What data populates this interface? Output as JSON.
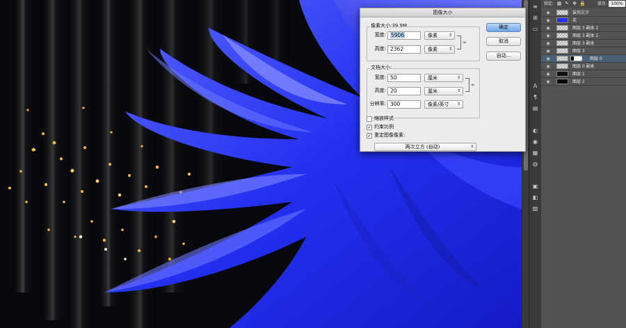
{
  "dialog": {
    "title": "图像大小",
    "pixel_dims": {
      "title": "像素大小:39.9M",
      "width_label": "宽度:",
      "width_value": "5906",
      "width_unit": "像素",
      "height_label": "高度:",
      "height_value": "2362",
      "height_unit": "像素"
    },
    "doc_size": {
      "title": "文档大小:",
      "width_label": "宽度:",
      "width_value": "50",
      "width_unit": "厘米",
      "height_label": "高度:",
      "height_value": "20",
      "height_unit": "厘米",
      "resolution_label": "分辨率:",
      "resolution_value": "300",
      "resolution_unit": "像素/英寸"
    },
    "options": {
      "scale_styles": {
        "label": "缩放样式",
        "checked": false
      },
      "constrain": {
        "label": "约束比例",
        "checked": true
      },
      "resample": {
        "label": "重定图像像素:",
        "checked": true
      },
      "resample_method": "两次立方 (自动)"
    },
    "buttons": {
      "ok": "确定",
      "cancel": "取消",
      "auto": "自动..."
    }
  },
  "layers": {
    "lock_label": "锁定:",
    "fill_label": "填充:",
    "fill_value": "100%",
    "items": [
      {
        "name": "装饰文字",
        "thumb": "checker",
        "selected": false
      },
      {
        "name": "花",
        "thumb": "blue",
        "selected": false
      },
      {
        "name": "图层 3 副本 2",
        "thumb": "checker",
        "selected": false
      },
      {
        "name": "图层 3 副本 2",
        "thumb": "checker",
        "selected": false
      },
      {
        "name": "图层 3 副本",
        "thumb": "checker",
        "selected": false
      },
      {
        "name": "图层 3",
        "thumb": "checker",
        "selected": false
      },
      {
        "name": "图层 0",
        "thumb": "checker",
        "selected": true
      },
      {
        "name": "图层 0 副本",
        "thumb": "checker",
        "selected": false
      },
      {
        "name": "图层 1",
        "thumb": "dark",
        "selected": false
      },
      {
        "name": "图层 2",
        "thumb": "black",
        "selected": false
      }
    ]
  },
  "colors": {
    "flower_blue": "#2233f2",
    "flower_light": "#6f7cff",
    "bokeh_gold": "#f3c25a",
    "panel_bg": "#535353",
    "selected_layer": "#4a6076"
  },
  "icons": {
    "visibility": "eye-icon",
    "link": "chain-link-icon",
    "checkbox": "checkmark-icon",
    "dropdown": "updown-arrow-icon"
  }
}
